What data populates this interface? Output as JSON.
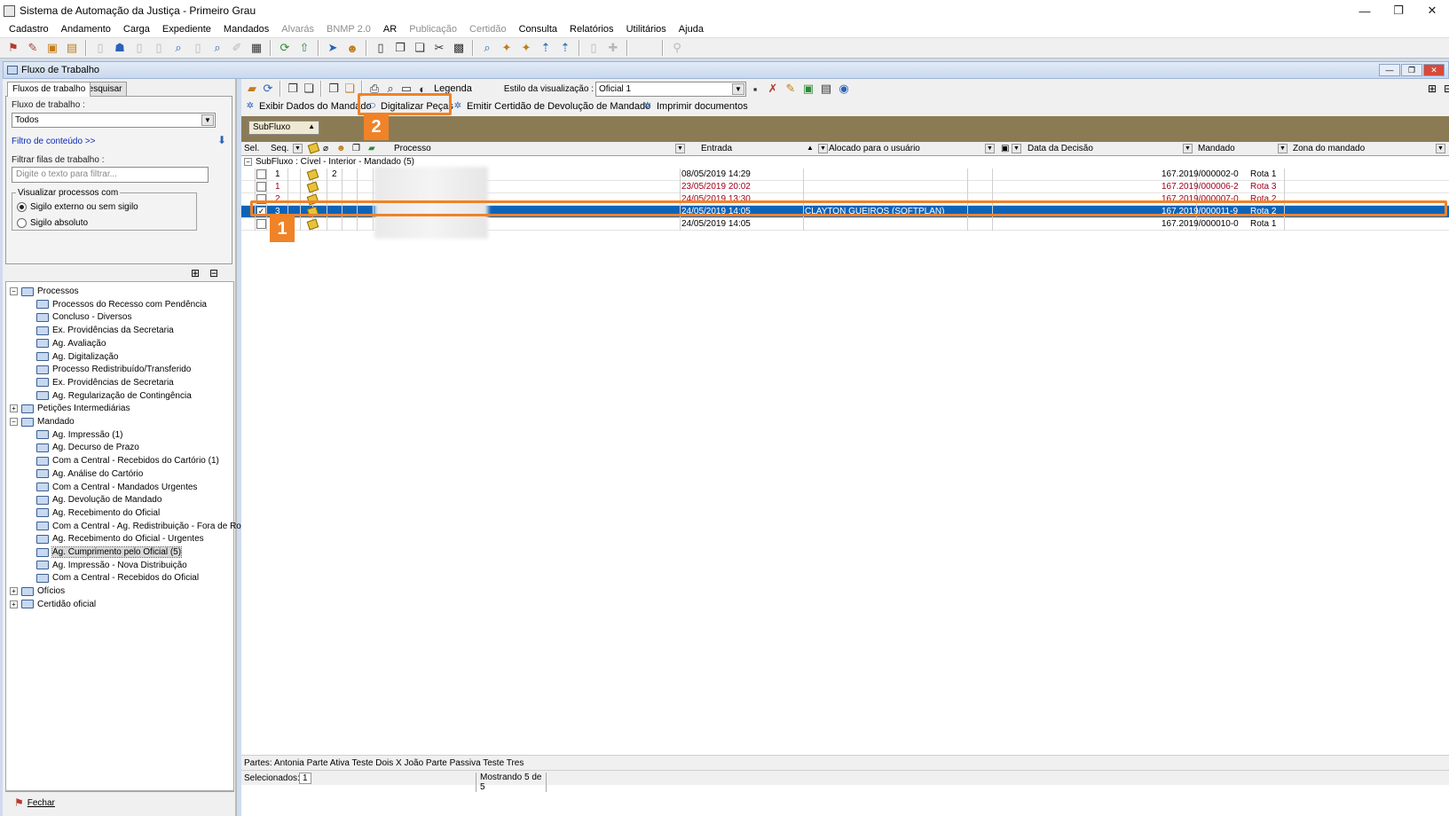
{
  "app": {
    "title": "Sistema de Automação da Justiça - Primeiro Grau",
    "window_controls": {
      "minimize": "—",
      "restore": "❐",
      "close": "✕"
    }
  },
  "menu": [
    {
      "label": "Cadastro",
      "enabled": true
    },
    {
      "label": "Andamento",
      "enabled": true
    },
    {
      "label": "Carga",
      "enabled": true
    },
    {
      "label": "Expediente",
      "enabled": true
    },
    {
      "label": "Mandados",
      "enabled": true
    },
    {
      "label": "Alvarás",
      "enabled": false
    },
    {
      "label": "BNMP 2.0",
      "enabled": false
    },
    {
      "label": "AR",
      "enabled": true
    },
    {
      "label": "Publicação",
      "enabled": false
    },
    {
      "label": "Certidão",
      "enabled": false
    },
    {
      "label": "Consulta",
      "enabled": true
    },
    {
      "label": "Relatórios",
      "enabled": true
    },
    {
      "label": "Utilitários",
      "enabled": true
    },
    {
      "label": "Ajuda",
      "enabled": true
    }
  ],
  "workflow_window": {
    "title": "Fluxo de Trabalho"
  },
  "left": {
    "tabs": [
      "Fluxos de trabalho",
      "Pesquisar"
    ],
    "fluxo_label": "Fluxo de trabalho :",
    "fluxo_value": "Todos",
    "filtro_link": "Filtro de conteúdo >>",
    "filtrar_label": "Filtrar filas de trabalho :",
    "filtrar_placeholder": "Digite o texto para filtrar...",
    "visualizar_legend": "Visualizar processos com",
    "radio_sigilo_externo": "Sigilo externo ou sem sigilo",
    "radio_sigilo_absoluto": "Sigilo absoluto",
    "footer_close": "Fechar"
  },
  "tree": [
    {
      "label": "Processos",
      "expander": "−"
    },
    {
      "label": "Processos do Recesso com Pendência"
    },
    {
      "label": "Concluso - Diversos"
    },
    {
      "label": "Ex. Providências da Secretaria"
    },
    {
      "label": "Ag. Avaliação"
    },
    {
      "label": "Ag. Digitalização"
    },
    {
      "label": "Processo Redistribuído/Transferido"
    },
    {
      "label": "Ex. Providências de Secretaria"
    },
    {
      "label": "Ag. Regularização de Contingência"
    },
    {
      "label": "Petições Intermediárias",
      "expander": "+"
    },
    {
      "label": "Mandado",
      "expander": "−"
    },
    {
      "label": "Ag. Impressão (1)"
    },
    {
      "label": "Ag. Decurso de Prazo"
    },
    {
      "label": "Com a Central - Recebidos do Cartório (1)"
    },
    {
      "label": "Ag. Análise do Cartório"
    },
    {
      "label": "Com a Central - Mandados Urgentes"
    },
    {
      "label": "Ag. Devolução de Mandado"
    },
    {
      "label": "Ag. Recebimento do Oficial"
    },
    {
      "label": "Com a Central - Ag. Redistribuição - Fora de Rota"
    },
    {
      "label": "Ag. Recebimento do Oficial - Urgentes"
    },
    {
      "label": "Ag. Cumprimento pelo Oficial (5)",
      "selected": true
    },
    {
      "label": "Ag. Impressão - Nova Distribuição"
    },
    {
      "label": "Com a Central - Recebidos do Oficial"
    },
    {
      "label": "Ofícios",
      "expander": "+"
    },
    {
      "label": "Certidão oficial",
      "expander": "+"
    }
  ],
  "right": {
    "legenda": "Legenda",
    "estilo_label": "Estilo da visualização :",
    "estilo_value": "Oficial 1",
    "actions": [
      "Exibir Dados do Mandado",
      "Digitalizar Peças",
      "Emitir Certidão de Devolução de Mandado",
      "Imprimir documentos"
    ],
    "group_chip": "SubFluxo",
    "columns": {
      "sel": "Sel.",
      "seq": "Seq.",
      "processo": "Processo",
      "entrada": "Entrada",
      "alocado": "Alocado para o usuário",
      "data_decisao": "Data da Decisão",
      "mandado": "Mandado",
      "zona": "Zona do mandado"
    },
    "group_row": "SubFluxo : Cível - Interior - Mandado  (5)",
    "rows": [
      {
        "checked": false,
        "seq": "1",
        "col2": "2",
        "entrada": "08/05/2019 14:29",
        "alocado": "",
        "mandado": "167.2019/000002-0",
        "zona": "Rota 1",
        "style": "normal"
      },
      {
        "checked": false,
        "seq": "1",
        "col2": "",
        "entrada": "23/05/2019 20:02",
        "alocado": "",
        "mandado": "167.2019/000006-2",
        "zona": "Rota 3",
        "style": "red"
      },
      {
        "checked": false,
        "seq": "2",
        "col2": "",
        "entrada": "24/05/2019 13:30",
        "alocado": "",
        "mandado": "167.2019/000007-0",
        "zona": "Rota 2",
        "style": "red"
      },
      {
        "checked": true,
        "seq": "3",
        "col2": "",
        "entrada": "24/05/2019 14:05",
        "alocado": "CLAYTON GUEIROS (SOFTPLAN)",
        "mandado": "167.2019/000011-9",
        "zona": "Rota 2",
        "style": "selected"
      },
      {
        "checked": false,
        "seq": "",
        "col2": "",
        "entrada": "24/05/2019 14:05",
        "alocado": "",
        "mandado": "167.2019/000010-0",
        "zona": "Rota 1",
        "style": "normal"
      }
    ],
    "status_partes": "Partes: Antonia Parte Ativa Teste Dois X João Parte Passiva Teste Tres",
    "selecionados_label": "Selecionados:",
    "selecionados_value": "1",
    "mostrando": "Mostrando 5 de 5"
  },
  "annotations": {
    "badge1": "1",
    "badge2": "2",
    "color": "#f08227"
  }
}
